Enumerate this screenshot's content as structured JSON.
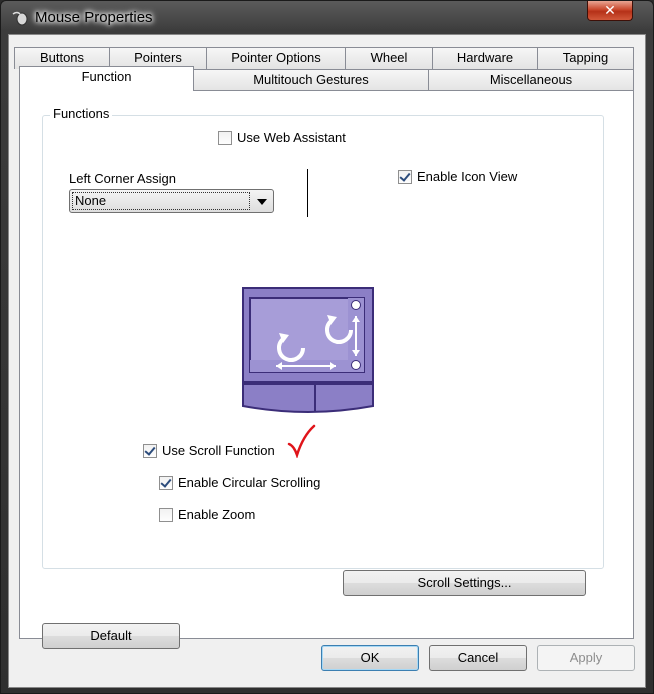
{
  "window": {
    "title": "Mouse Properties",
    "close_label": "✕"
  },
  "tabs": {
    "row1": [
      "Buttons",
      "Pointers",
      "Pointer Options",
      "Wheel",
      "Hardware",
      "Tapping"
    ],
    "row2": [
      "Function",
      "Multitouch Gestures",
      "Miscellaneous"
    ],
    "active": "Function"
  },
  "functions": {
    "group_label": "Functions",
    "use_web_assistant": {
      "label": "Use Web Assistant",
      "checked": false
    },
    "left_corner_assign": {
      "label": "Left Corner Assign",
      "value": "None"
    },
    "enable_icon_view": {
      "label": "Enable Icon View",
      "checked": true
    },
    "use_scroll_function": {
      "label": "Use Scroll Function",
      "checked": true
    },
    "enable_circular_scrolling": {
      "label": "Enable Circular Scrolling",
      "checked": true
    },
    "enable_zoom": {
      "label": "Enable Zoom",
      "checked": false
    },
    "scroll_settings_label": "Scroll Settings..."
  },
  "buttons": {
    "default_label": "Default",
    "ok_label": "OK",
    "cancel_label": "Cancel",
    "apply_label": "Apply"
  },
  "colors": {
    "touchpad_fill": "#8b7fc6",
    "touchpad_border": "#3b2d78",
    "annotation_check": "#e0141a"
  }
}
